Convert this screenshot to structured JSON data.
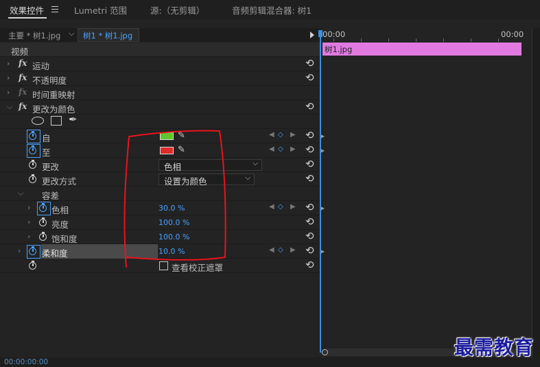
{
  "tabs": [
    {
      "label": "效果控件"
    },
    {
      "label": "Lumetri 范围"
    },
    {
      "label": "源:（无剪辑）"
    },
    {
      "label": "音频剪辑混合器: 树1"
    }
  ],
  "clip_header": {
    "master": "主要 * 树1.jpg",
    "sequence_clip": "树1 * 树1.jpg"
  },
  "section_video": "视频",
  "effects": {
    "motion": "运动",
    "opacity": "不透明度",
    "time_remap": "时间重映射",
    "change_to_color": "更改为颜色"
  },
  "fx_glyph": "fx",
  "props": {
    "from": {
      "label": "自",
      "color": "#5fc62b"
    },
    "to": {
      "label": "至",
      "color": "#e12a2a"
    },
    "change": {
      "label": "更改",
      "value": "色相"
    },
    "change_by": {
      "label": "更改方式",
      "value": "设置为颜色"
    },
    "tolerance": {
      "label": "容差"
    },
    "hue": {
      "label": "色相",
      "value": "30.0 %"
    },
    "lightness": {
      "label": "亮度",
      "value": "100.0 %"
    },
    "saturation": {
      "label": "饱和度",
      "value": "100.0 %"
    },
    "softness": {
      "label": "柔和度",
      "value": "10.0 %"
    },
    "view_mask": {
      "label": "查看校正遮罩"
    }
  },
  "timeline": {
    "tc_start": "00:00",
    "tc_end": "00:00",
    "clip_name": "树1.jpg"
  },
  "status": {
    "timecode": "00:00:00:00"
  },
  "watermark": "最需教育",
  "annotation_color": "#e8141c"
}
